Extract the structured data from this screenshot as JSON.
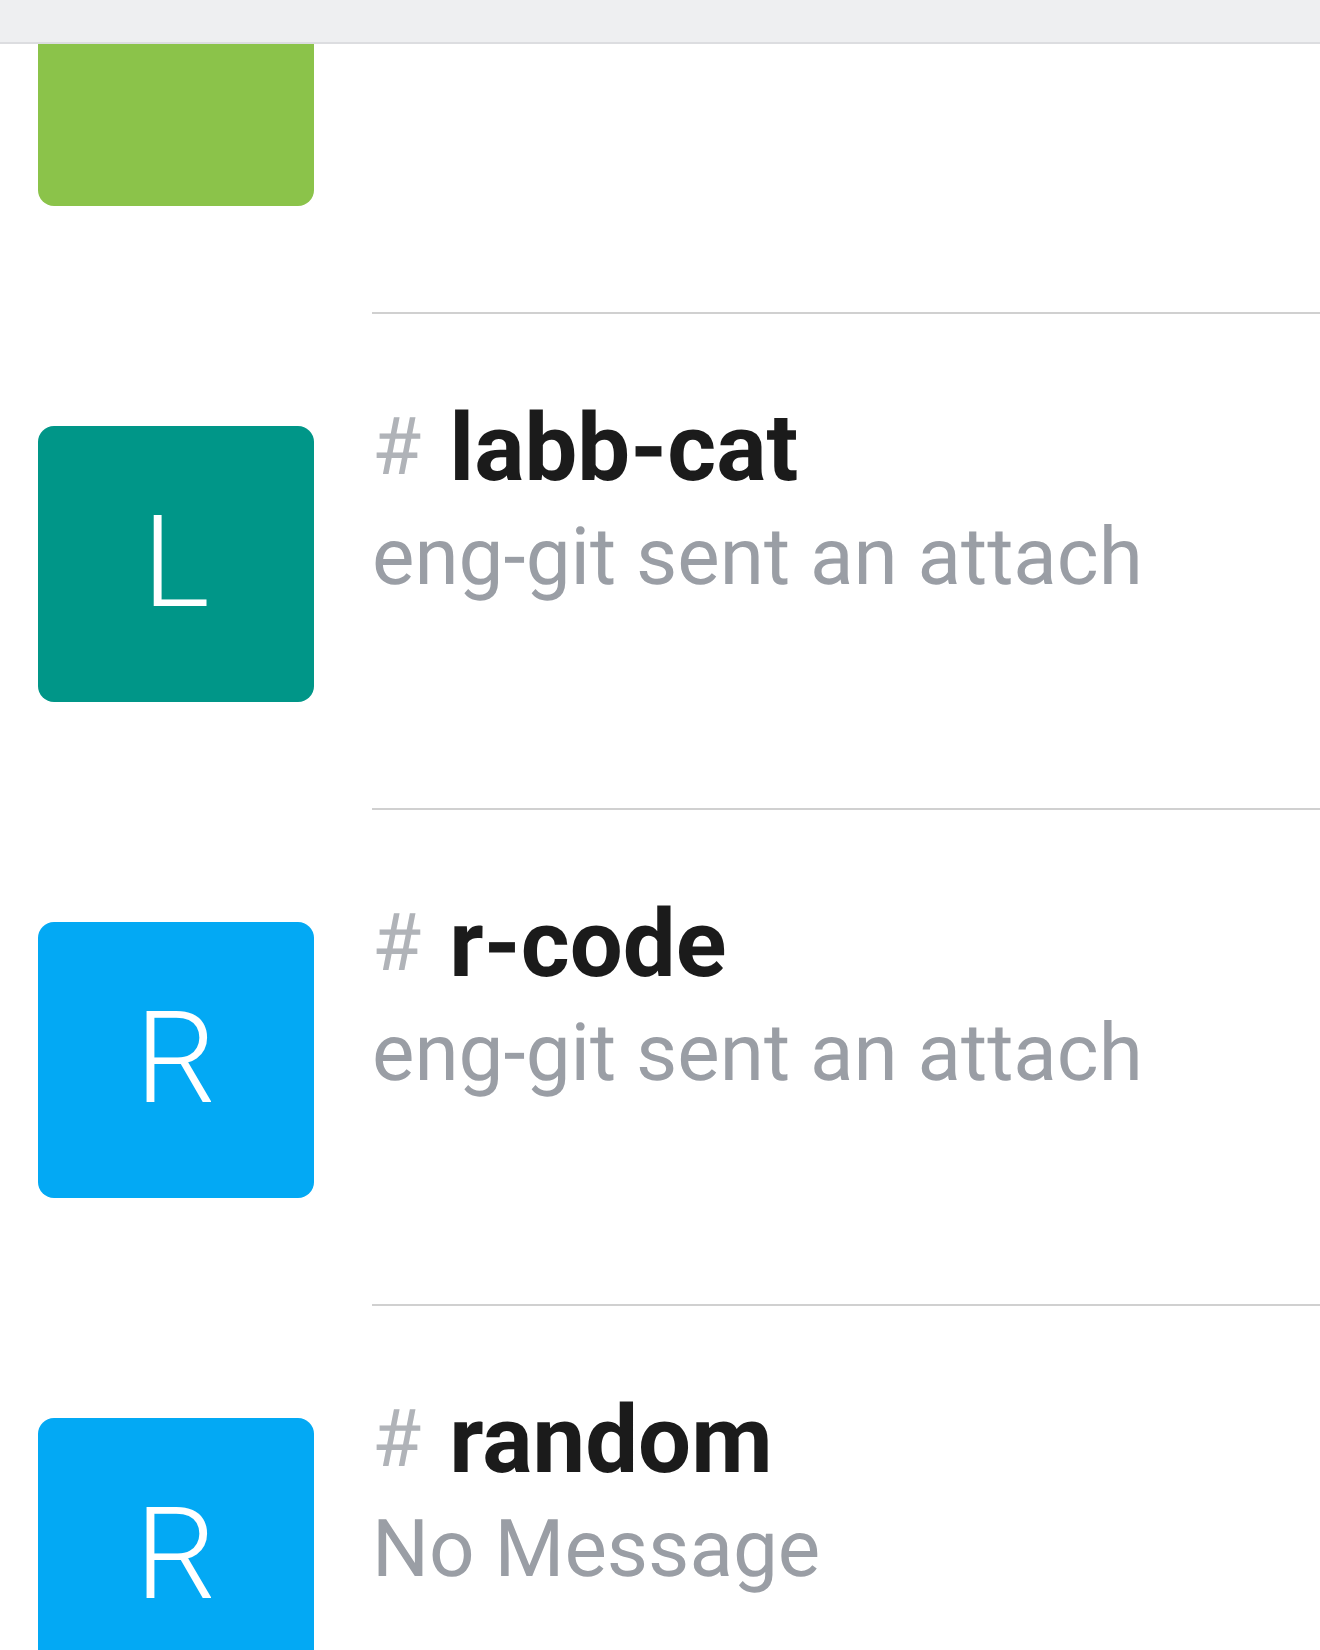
{
  "channels": [
    {
      "color": "#8bc34a"
    },
    {
      "initial": "L",
      "color": "#009688",
      "prefix": "#",
      "name": "labb-cat",
      "preview": "eng-git sent an attach"
    },
    {
      "initial": "R",
      "color": "#03a9f4",
      "prefix": "#",
      "name": "r-code",
      "preview": "eng-git sent an attach"
    },
    {
      "initial": "R",
      "color": "#03a9f4",
      "prefix": "#",
      "name": "random",
      "preview": "No Message"
    }
  ]
}
